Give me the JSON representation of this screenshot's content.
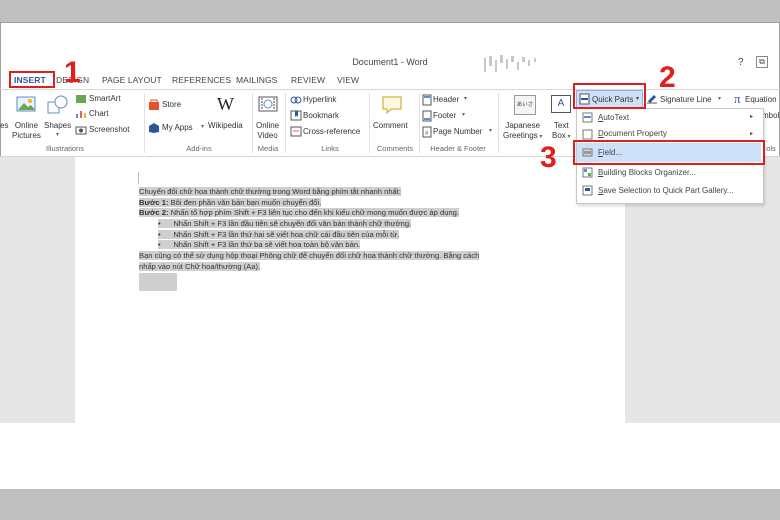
{
  "window": {
    "title": "Document1 - Word",
    "help": "?",
    "restore": "⧉"
  },
  "tabs": [
    "INSERT",
    "DESIGN",
    "PAGE LAYOUT",
    "REFERENCES",
    "MAILINGS",
    "REVIEW",
    "VIEW"
  ],
  "ribbon": {
    "illustrations": {
      "partial": "es",
      "online_pictures": [
        "Online",
        "Pictures"
      ],
      "shapes": "Shapes",
      "smartart": "SmartArt",
      "chart": "Chart",
      "screenshot": "Screenshot",
      "group": "Illustrations"
    },
    "addins": {
      "store": "Store",
      "my_apps": "My Apps",
      "wikipedia": "Wikipedia",
      "wikipedia_glyph": "W",
      "group": "Add-ins"
    },
    "media": {
      "online_video": [
        "Online",
        "Video"
      ],
      "group": "Media"
    },
    "links": {
      "hyperlink": "Hyperlink",
      "bookmark": "Bookmark",
      "cross_reference": "Cross-reference",
      "group": "Links"
    },
    "comments": {
      "comment": "Comment",
      "group": "Comments"
    },
    "header_footer": {
      "header": "Header",
      "footer": "Footer",
      "page_number": "Page Number",
      "group": "Header & Footer"
    },
    "text": {
      "japanese_greetings": [
        "Japanese",
        "Greetings"
      ],
      "japanese_icon_text": "あいさつ",
      "text_box": [
        "Text",
        "Box"
      ],
      "text_box_glyph": "A",
      "quick_parts": "Quick Parts",
      "signature_line": "Signature Line",
      "equation": "Equation",
      "equation_glyph": "π",
      "symbol_partial": "mbol",
      "group_partial": "ols"
    }
  },
  "quick_parts_menu": {
    "items": [
      {
        "label": "AutoText",
        "underline": "A",
        "rest": "utoText",
        "submenu": true
      },
      {
        "label": "Document Property",
        "underline": "D",
        "rest": "ocument Property",
        "submenu": true
      },
      {
        "label": "Field...",
        "underline": "F",
        "rest": "ield...",
        "submenu": false
      },
      {
        "label": "Building Blocks Organizer...",
        "underline": "B",
        "rest": "uilding Blocks Organizer...",
        "submenu": false
      },
      {
        "label": "Save Selection to Quick Part Gallery...",
        "underline": "S",
        "rest": "ave Selection to Quick Part Gallery...",
        "submenu": false
      }
    ]
  },
  "document": {
    "line1": "Chuyển đổi chữ hoa thành chữ thường trong Word bằng phím tắt nhanh nhất:",
    "step1_label": "Bước 1:",
    "step1_text": " Bôi đen phần văn bản bạn muốn chuyển đổi.",
    "step2_label": "Bước 2:",
    "step2_text": " Nhấn tổ hợp phím Shift + F3 liên tục cho đến khi kiểu chữ mong muốn được áp dụng.",
    "bullets": [
      "Nhấn Shift + F3 lần đầu tiên sẽ chuyển đổi văn bản thành chữ thường.",
      "Nhấn Shift + F3 lần thứ hai sẽ viết hoa chữ cái đầu tiên của mỗi từ.",
      "Nhấn Shift + F3 lần thứ ba sẽ viết hoa toàn bộ văn bản."
    ],
    "para_line1": "Bạn cũng có thể sử dụng hộp thoại Phông chữ để chuyển đổi chữ hoa thành chữ thường. Bằng cách",
    "para_line2": "nhấp vào nút Chữ hoa/thường (Aa)."
  },
  "annotations": {
    "n1": "1",
    "n2": "2",
    "n3": "3",
    "color": "#e01e1e"
  },
  "colors": {
    "accent": "#2b579a",
    "highlight": "#cfcfcf",
    "menu_hover": "#cde0f7"
  }
}
